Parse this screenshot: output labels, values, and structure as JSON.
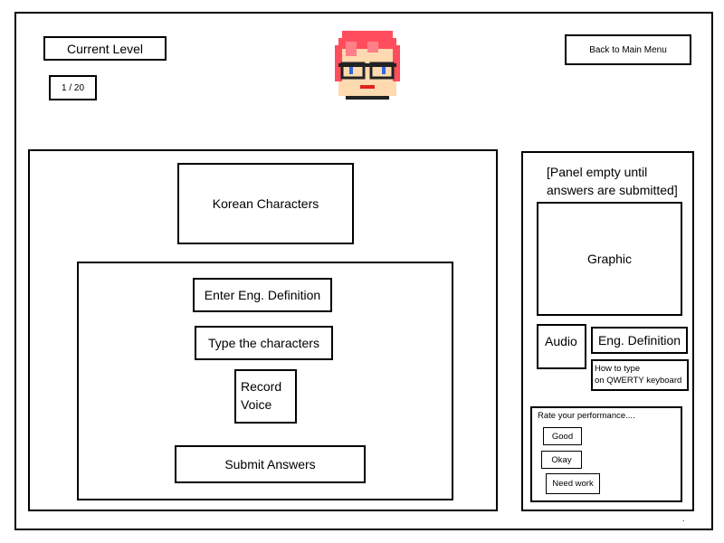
{
  "header": {
    "current_level_label": "Current Level",
    "level_counter": "1 / 20",
    "back_button_label": "Back to Main Menu"
  },
  "quiz": {
    "prompt_label": "Korean Characters",
    "definition_input_label": "Enter Eng. Definition",
    "type_characters_label": "Type the characters",
    "record_voice_line1": "Record",
    "record_voice_line2": "Voice",
    "submit_label": "Submit Answers"
  },
  "feedback": {
    "note_line1": "[Panel empty until",
    "note_line2": "answers are submitted]",
    "graphic_label": "Graphic",
    "audio_label": "Audio",
    "definition_label": "Eng. Definition",
    "how_to_type_line1": "How to type",
    "how_to_type_line2": "on QWERTY keyboard",
    "rating": {
      "prompt": "Rate your performance....",
      "options": [
        "Good",
        "Okay",
        "Need work"
      ]
    }
  },
  "footer": {
    "dot": "."
  },
  "avatar": {
    "icon": "pixel-character-face-icon",
    "hair_color": "#ff4d5e",
    "lens_color": "#2a6be0"
  }
}
